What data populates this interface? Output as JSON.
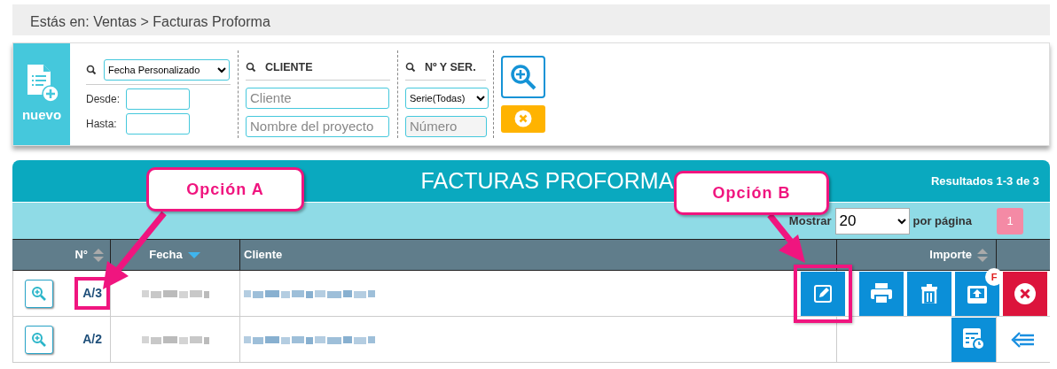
{
  "breadcrumb": "Estás en: Ventas > Facturas Proforma",
  "new_button": {
    "label": "nuevo"
  },
  "filters": {
    "date": {
      "select": "Fecha Personalizado",
      "from_label": "Desde:",
      "to_label": "Hasta:"
    },
    "client": {
      "heading": "CLIENTE",
      "placeholders": [
        "Cliente",
        "Nombre del proyecto"
      ]
    },
    "number": {
      "heading": "Nº Y SER.",
      "select": "Serie(Todas)",
      "placeholder": "Número"
    }
  },
  "table": {
    "title": "FACTURAS PROFORMA",
    "results": "Resultados 1-3 de 3",
    "show_label": "Mostrar",
    "page_size": "20",
    "per_page_label": "por página",
    "pages": [
      {
        "label": "1",
        "selected": true
      }
    ],
    "columns": [
      {
        "label": "N°",
        "kind": "sortable"
      },
      {
        "label": "Fecha",
        "kind": "sorted"
      },
      {
        "label": "Cliente",
        "kind": "plain"
      },
      {
        "label": "Importe",
        "kind": "sortable"
      }
    ],
    "rows": [
      {
        "number": "A/3",
        "highlighted": true,
        "actions": [
          {
            "kind": "edit",
            "highlighted": true
          },
          {
            "kind": "print",
            "highlighted": false
          },
          {
            "kind": "delete",
            "highlighted": false
          },
          {
            "kind": "upload",
            "highlighted": false,
            "badge": "F"
          },
          {
            "kind": "cancel",
            "highlighted": false
          }
        ]
      },
      {
        "number": "A/2",
        "highlighted": false,
        "actions": [
          {
            "kind": "history",
            "highlighted": false
          },
          {
            "kind": "back",
            "highlighted": false
          }
        ]
      }
    ]
  },
  "annotations": [
    {
      "label": "Opción A"
    },
    {
      "label": "Opción B"
    }
  ]
}
